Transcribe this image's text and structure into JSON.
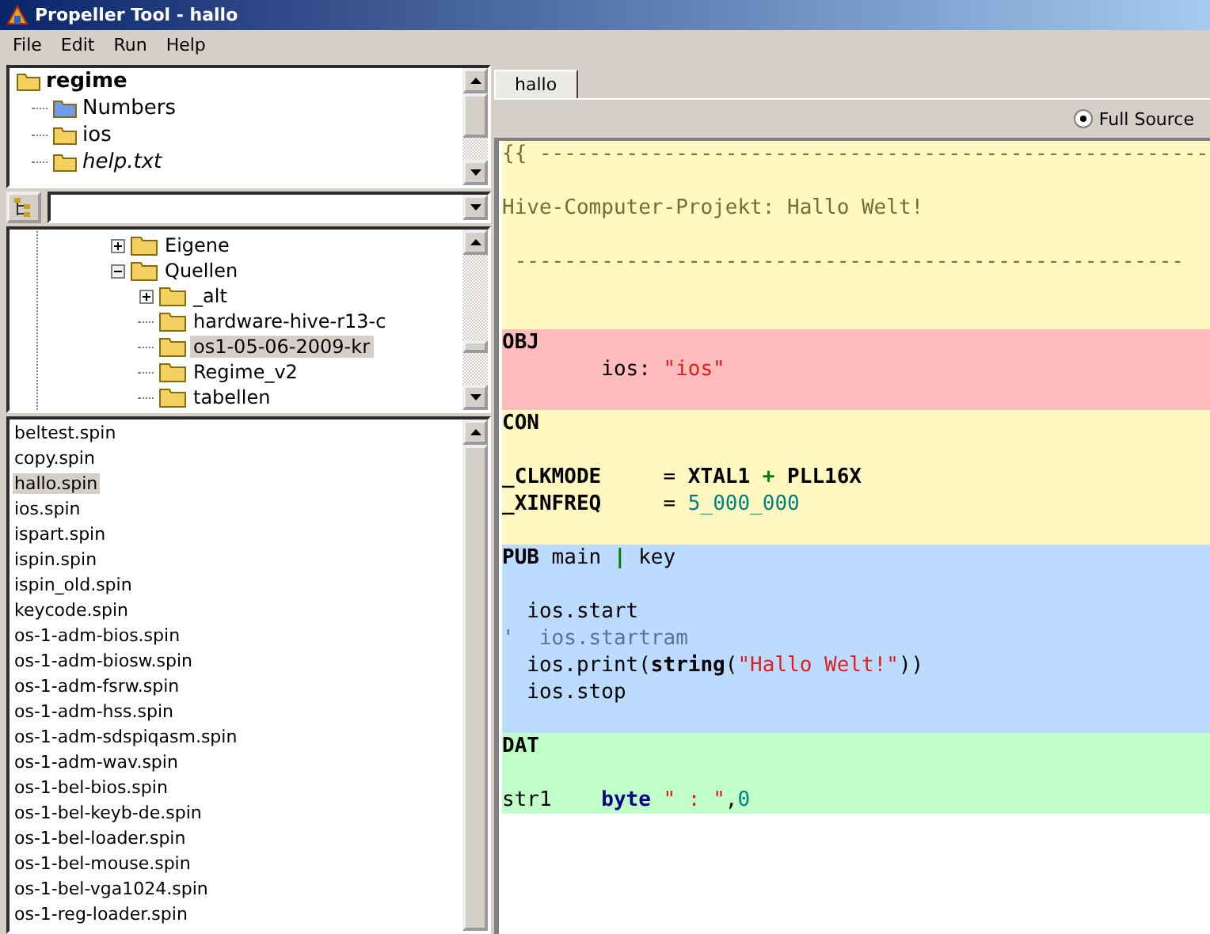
{
  "window": {
    "title": "Propeller Tool - hallo"
  },
  "menu": [
    "File",
    "Edit",
    "Run",
    "Help"
  ],
  "project_tree": [
    {
      "label": "regime",
      "kind": "root",
      "children": [
        {
          "label": "Numbers",
          "kind": "library"
        },
        {
          "label": "ios",
          "kind": "folder"
        },
        {
          "label": "help.txt",
          "kind": "document"
        }
      ]
    }
  ],
  "folder_tree": [
    {
      "label": "Eigene",
      "kind": "branch",
      "expanded": false,
      "selected": false
    },
    {
      "label": "Quellen",
      "kind": "branch",
      "expanded": true,
      "selected": false,
      "children": [
        {
          "label": "_alt",
          "kind": "branch",
          "expanded": false,
          "selected": false
        },
        {
          "label": "hardware-hive-r13-c",
          "kind": "leaf",
          "selected": false
        },
        {
          "label": "os1-05-06-2009-kr",
          "kind": "leaf",
          "selected": true
        },
        {
          "label": "Regime_v2",
          "kind": "leaf",
          "selected": false
        },
        {
          "label": "tabellen",
          "kind": "leaf",
          "selected": false
        }
      ]
    }
  ],
  "files": [
    {
      "name": "beltest.spin",
      "selected": false
    },
    {
      "name": "copy.spin",
      "selected": false
    },
    {
      "name": "hallo.spin",
      "selected": true
    },
    {
      "name": "ios.spin",
      "selected": false
    },
    {
      "name": "ispart.spin",
      "selected": false
    },
    {
      "name": "ispin.spin",
      "selected": false
    },
    {
      "name": "ispin_old.spin",
      "selected": false
    },
    {
      "name": "keycode.spin",
      "selected": false
    },
    {
      "name": "os-1-adm-bios.spin",
      "selected": false
    },
    {
      "name": "os-1-adm-biosw.spin",
      "selected": false
    },
    {
      "name": "os-1-adm-fsrw.spin",
      "selected": false
    },
    {
      "name": "os-1-adm-hss.spin",
      "selected": false
    },
    {
      "name": "os-1-adm-sdspiqasm.spin",
      "selected": false
    },
    {
      "name": "os-1-adm-wav.spin",
      "selected": false
    },
    {
      "name": "os-1-bel-bios.spin",
      "selected": false
    },
    {
      "name": "os-1-bel-keyb-de.spin",
      "selected": false
    },
    {
      "name": "os-1-bel-loader.spin",
      "selected": false
    },
    {
      "name": "os-1-bel-mouse.spin",
      "selected": false
    },
    {
      "name": "os-1-bel-vga1024.spin",
      "selected": false
    },
    {
      "name": "os-1-reg-loader.spin",
      "selected": false
    }
  ],
  "tabs": [
    {
      "label": "hallo",
      "selected": true
    }
  ],
  "view_option": {
    "label": "Full Source",
    "selected": true
  },
  "code_sections": [
    {
      "kind": "doc",
      "lines": [
        {
          "kind": "code",
          "tokens": [
            {
              "kind": "comment",
              "text": "{{ ------------------------------------------------------"
            }
          ]
        },
        {
          "kind": "blank"
        },
        {
          "kind": "code",
          "tokens": [
            {
              "kind": "comment",
              "text": "Hive-Computer-Projekt: Hallo Welt!"
            }
          ]
        },
        {
          "kind": "blank"
        },
        {
          "kind": "code",
          "tokens": [
            {
              "kind": "comment",
              "text": " ------------------------------------------------------"
            }
          ]
        },
        {
          "kind": "blank"
        },
        {
          "kind": "blank"
        }
      ]
    },
    {
      "kind": "obj",
      "lines": [
        {
          "kind": "code",
          "tokens": [
            {
              "kind": "block",
              "text": "OBJ"
            }
          ]
        },
        {
          "kind": "code",
          "tokens": [
            {
              "kind": "plain",
              "text": "        ios: "
            },
            {
              "kind": "string",
              "text": "\"ios\""
            }
          ]
        },
        {
          "kind": "blank"
        }
      ]
    },
    {
      "kind": "con",
      "lines": [
        {
          "kind": "code",
          "tokens": [
            {
              "kind": "block",
              "text": "CON"
            }
          ]
        },
        {
          "kind": "blank"
        },
        {
          "kind": "code",
          "tokens": [
            {
              "kind": "bold",
              "text": "_CLKMODE"
            },
            {
              "kind": "plain",
              "text": "     = "
            },
            {
              "kind": "bold",
              "text": "XTAL1"
            },
            {
              "kind": "operator",
              "text": " + "
            },
            {
              "kind": "bold",
              "text": "PLL16X"
            }
          ]
        },
        {
          "kind": "code",
          "tokens": [
            {
              "kind": "bold",
              "text": "_XINFREQ"
            },
            {
              "kind": "plain",
              "text": "     = "
            },
            {
              "kind": "number",
              "text": "5_000_000"
            }
          ]
        },
        {
          "kind": "blank"
        }
      ]
    },
    {
      "kind": "pub",
      "lines": [
        {
          "kind": "code",
          "tokens": [
            {
              "kind": "block",
              "text": "PUB"
            },
            {
              "kind": "plain",
              "text": " main "
            },
            {
              "kind": "operator",
              "text": "|"
            },
            {
              "kind": "plain",
              "text": " key"
            }
          ]
        },
        {
          "kind": "blank"
        },
        {
          "kind": "code",
          "tokens": [
            {
              "kind": "plain",
              "text": "  ios.start"
            }
          ]
        },
        {
          "kind": "code",
          "tokens": [
            {
              "kind": "comment_line",
              "text": "'  ios.startram"
            }
          ]
        },
        {
          "kind": "code",
          "tokens": [
            {
              "kind": "plain",
              "text": "  ios.print("
            },
            {
              "kind": "bold",
              "text": "string"
            },
            {
              "kind": "plain",
              "text": "("
            },
            {
              "kind": "string",
              "text": "\"Hallo Welt!\""
            },
            {
              "kind": "plain",
              "text": "))"
            }
          ]
        },
        {
          "kind": "code",
          "tokens": [
            {
              "kind": "plain",
              "text": "  ios.stop"
            }
          ]
        },
        {
          "kind": "blank"
        }
      ]
    },
    {
      "kind": "dat",
      "lines": [
        {
          "kind": "code",
          "tokens": [
            {
              "kind": "block",
              "text": "DAT"
            }
          ]
        },
        {
          "kind": "blank"
        },
        {
          "kind": "code",
          "tokens": [
            {
              "kind": "plain",
              "text": "str1    "
            },
            {
              "kind": "keyword",
              "text": "byte"
            },
            {
              "kind": "string",
              "text": " \" : \""
            },
            {
              "kind": "plain",
              "text": ","
            },
            {
              "kind": "number",
              "text": "0"
            }
          ]
        }
      ]
    }
  ]
}
